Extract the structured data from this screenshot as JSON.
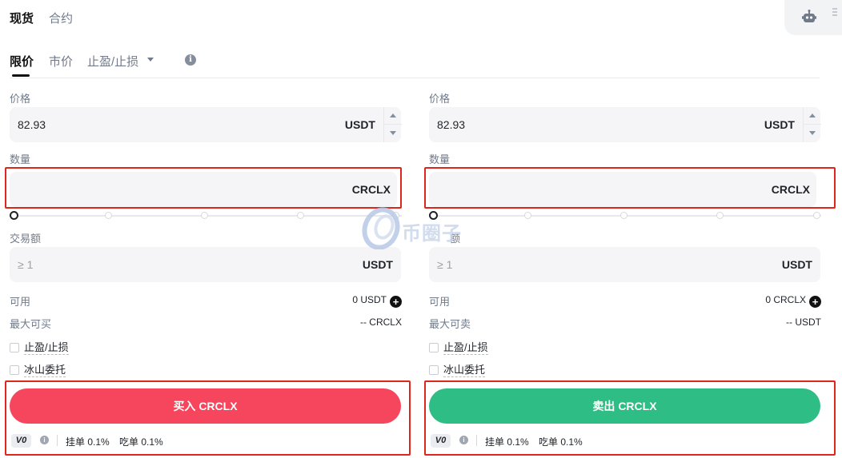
{
  "top_tabs": [
    {
      "label": "现货",
      "active": true
    },
    {
      "label": "合约",
      "active": false
    }
  ],
  "order_tabs": [
    {
      "label": "限价",
      "active": true
    },
    {
      "label": "市价",
      "active": false
    },
    {
      "label": "止盈/止损",
      "active": false,
      "dropdown": true
    }
  ],
  "info_glyph": "i",
  "buy": {
    "price_label": "价格",
    "price_value": "82.93",
    "price_unit": "USDT",
    "qty_label": "数量",
    "qty_unit": "CRCLX",
    "amount_label": "交易额",
    "amount_placeholder": "≥ 1",
    "amount_unit": "USDT",
    "available_label": "可用",
    "available_value": "0 USDT",
    "max_label": "最大可买",
    "max_value": "-- CRCLX",
    "tpsl_label": "止盈/止损",
    "iceberg_label": "冰山委托",
    "button_label": "买入 CRCLX",
    "fee_level": "V0",
    "maker_fee": "挂单 0.1%",
    "taker_fee": "吃单 0.1%"
  },
  "sell": {
    "price_label": "价格",
    "price_value": "82.93",
    "price_unit": "USDT",
    "qty_label": "数量",
    "qty_unit": "CRCLX",
    "amount_label": "额",
    "amount_placeholder": "≥ 1",
    "amount_unit": "USDT",
    "available_label": "可用",
    "available_value": "0 CRCLX",
    "max_label": "最大可卖",
    "max_value": "-- USDT",
    "tpsl_label": "止盈/止损",
    "iceberg_label": "冰山委托",
    "button_label": "卖出 CRCLX",
    "fee_level": "V0",
    "maker_fee": "挂单 0.1%",
    "taker_fee": "吃单 0.1%"
  },
  "watermark": {
    "text": "币圈子"
  },
  "colors": {
    "buy": "#f6465d",
    "sell": "#2ebd85",
    "highlight_box": "#e0261b",
    "field_bg": "#f5f5f7"
  },
  "icons": {
    "bot": "robot-icon",
    "info": "info-icon",
    "add": "plus-circle-icon"
  }
}
